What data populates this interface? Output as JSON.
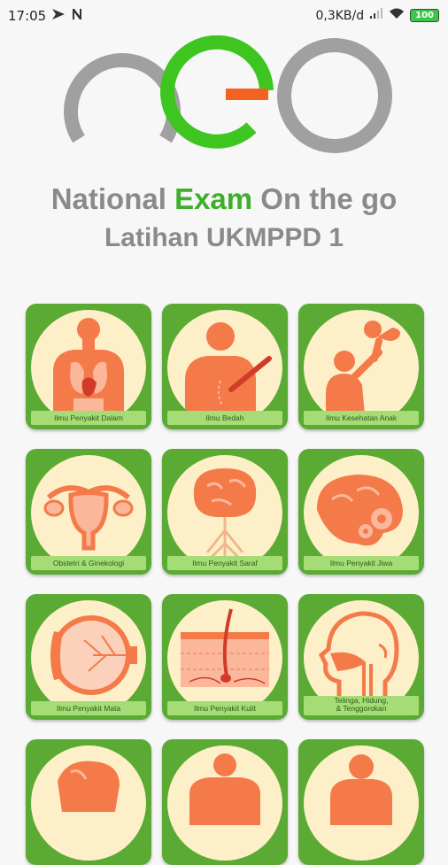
{
  "status_bar": {
    "time": "17:05",
    "left_icons": [
      "play-icon",
      "n-notification-icon"
    ],
    "net_speed": "0,3KB/d",
    "right_icons": [
      "signal-icon",
      "wifi-icon",
      "battery-icon"
    ],
    "battery": "100"
  },
  "logo": {
    "letters": "neo",
    "colors": {
      "gray": "#a0a0a0",
      "green": "#3fc51f",
      "orange": "#f26322"
    }
  },
  "header": {
    "title_part1": "National ",
    "title_part2": "Exam",
    "title_part3": " On the go",
    "subtitle": "Latihan UKMPPD 1"
  },
  "categories": [
    {
      "label": "Ilmu Penyakit Dalam",
      "icon": "internal-organs-icon"
    },
    {
      "label": "Ilmu Bedah",
      "icon": "scalpel-surgery-icon"
    },
    {
      "label": "Ilmu Kesehatan Anak",
      "icon": "mother-child-icon"
    },
    {
      "label": "Obstetri & Ginekologi",
      "icon": "uterus-icon"
    },
    {
      "label": "Ilmu Penyakit Saraf",
      "icon": "brain-nerves-icon"
    },
    {
      "label": "Ilmu Penyakit Jiwa",
      "icon": "brain-gears-icon"
    },
    {
      "label": "Ilmu Penyakit Mata",
      "icon": "eye-icon"
    },
    {
      "label": "Ilmu Penyakit Kulit",
      "icon": "skin-icon"
    },
    {
      "label_lines": [
        "Telinga, Hidung,",
        "& Tenggorokan"
      ],
      "icon": "ent-head-icon"
    },
    {
      "label": "",
      "icon": "partial-organ-icon"
    },
    {
      "label": "",
      "icon": "partial-body-icon"
    },
    {
      "label": "",
      "icon": "partial-person-icon"
    }
  ],
  "colors": {
    "tile_green": "#5aaa34",
    "circle_cream": "#fdf0c8",
    "band_green": "#a5dc76",
    "illustration_orange": "#f47a4a"
  }
}
